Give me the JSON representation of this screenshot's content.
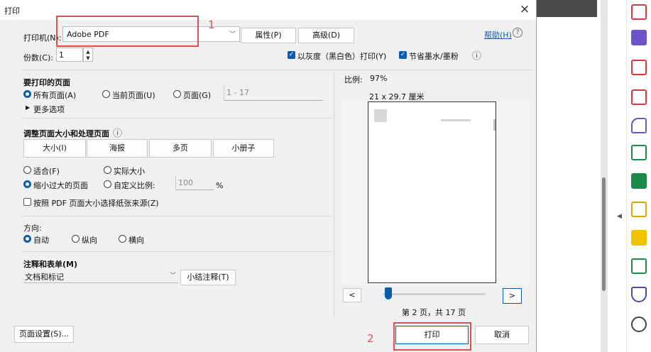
{
  "dialog": {
    "title": "打印",
    "close_glyph": "×",
    "printer_label": "打印机(N):",
    "printer_value": "Adobe PDF",
    "properties_button": "属性(P)",
    "advanced_button": "高级(D)",
    "help_link": "帮助(H)",
    "help_icon": "?",
    "copies_label": "份数(C):",
    "copies_value": "1",
    "grayscale_label": "以灰度（黑白色）打印(Y)",
    "grayscale_checked": true,
    "save_ink_label": "节省墨水/墨粉",
    "save_ink_checked": true,
    "info_icon": "ⓘ"
  },
  "pages_section": {
    "title": "要打印的页面",
    "all_pages": "所有页面(A)",
    "current_page": "当前页面(U)",
    "pages": "页面(G)",
    "range_value": "1 - 17",
    "more_options": "更多选项",
    "selected": "all"
  },
  "size_section": {
    "title": "调整页面大小和处理页面",
    "info_icon": "ⓘ",
    "tabs": [
      "大小(I)",
      "海报",
      "多页",
      "小册子"
    ],
    "fit": "适合(F)",
    "actual_size": "实际大小",
    "shrink_oversized": "缩小过大的页面",
    "custom_scale": "自定义比例:",
    "scale_value": "100",
    "scale_unit": "%",
    "choose_source": "按照 PDF 页面大小选择纸张来源(Z)",
    "selected": "shrink"
  },
  "orientation_section": {
    "title": "方向:",
    "auto": "自动",
    "portrait": "纵向",
    "landscape": "横向",
    "selected": "auto"
  },
  "comments_section": {
    "title": "注释和表单(M)",
    "dropdown_value": "文档和标记",
    "summarize_button": "小结注释(T)"
  },
  "preview": {
    "scale_label": "比例:",
    "scale_value": "97%",
    "paper_size": "21 x 29.7 厘米",
    "prev_button": "<",
    "next_button": ">",
    "slider_position": 0.08,
    "page_status": "第 2 页，共 17 页"
  },
  "footer": {
    "page_setup_button": "页面设置(S)...",
    "print_button": "打印",
    "cancel_button": "取消"
  },
  "annotations": {
    "marker_1": "1",
    "marker_2": "2"
  },
  "colors": {
    "accent": "#0b5cad",
    "annotation_red": "#e05050",
    "dialog_bg": "#f0f0f0"
  },
  "sidebar_icons": [
    "pdf-create-icon",
    "export-pdf-icon",
    "organize-pages-icon",
    "edit-pdf-icon",
    "fill-sign-icon",
    "add-pdf-icon",
    "compress-pdf-icon",
    "send-comments-icon",
    "comment-icon",
    "print-production-icon",
    "protect-icon",
    "more-tools-icon"
  ]
}
